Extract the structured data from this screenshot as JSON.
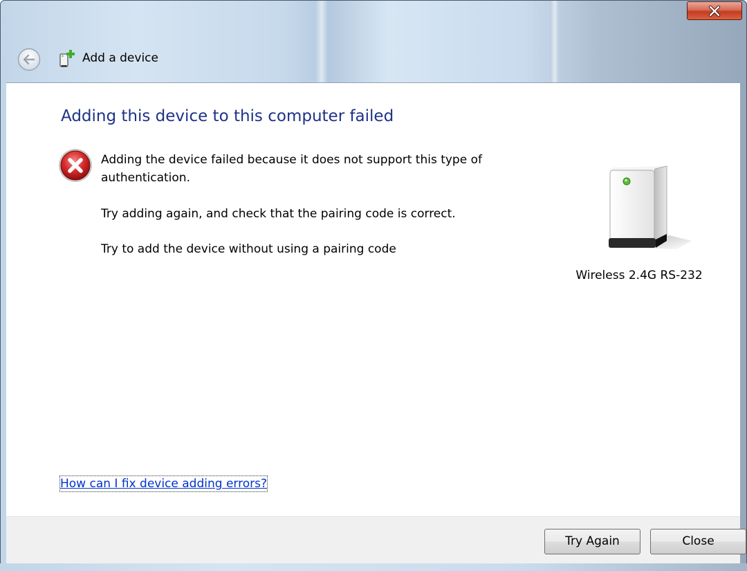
{
  "window": {
    "title": "Add a device",
    "close_icon": "close-icon",
    "back_icon": "back-arrow-icon",
    "device_icon": "add-device-icon",
    "close_color": "#c8442b"
  },
  "content": {
    "heading": "Adding this device to this computer failed",
    "error_icon": "error-icon",
    "error_color": "#c81e1e",
    "message": "Adding the device failed because it does not support this type of authentication.",
    "suggestion_retry": "Try adding again, and check that the pairing code is correct.",
    "suggestion_no_code": "Try to add the device without using a pairing code",
    "help_link": "How can I fix device adding errors?",
    "link_color": "#0033cc",
    "heading_color": "#1e3287"
  },
  "device": {
    "name": "Wireless 2.4G RS-232",
    "icon": "device-tower-icon",
    "led_color": "#5cbf3a"
  },
  "buttons": {
    "try_again": "Try Again",
    "close": "Close"
  }
}
